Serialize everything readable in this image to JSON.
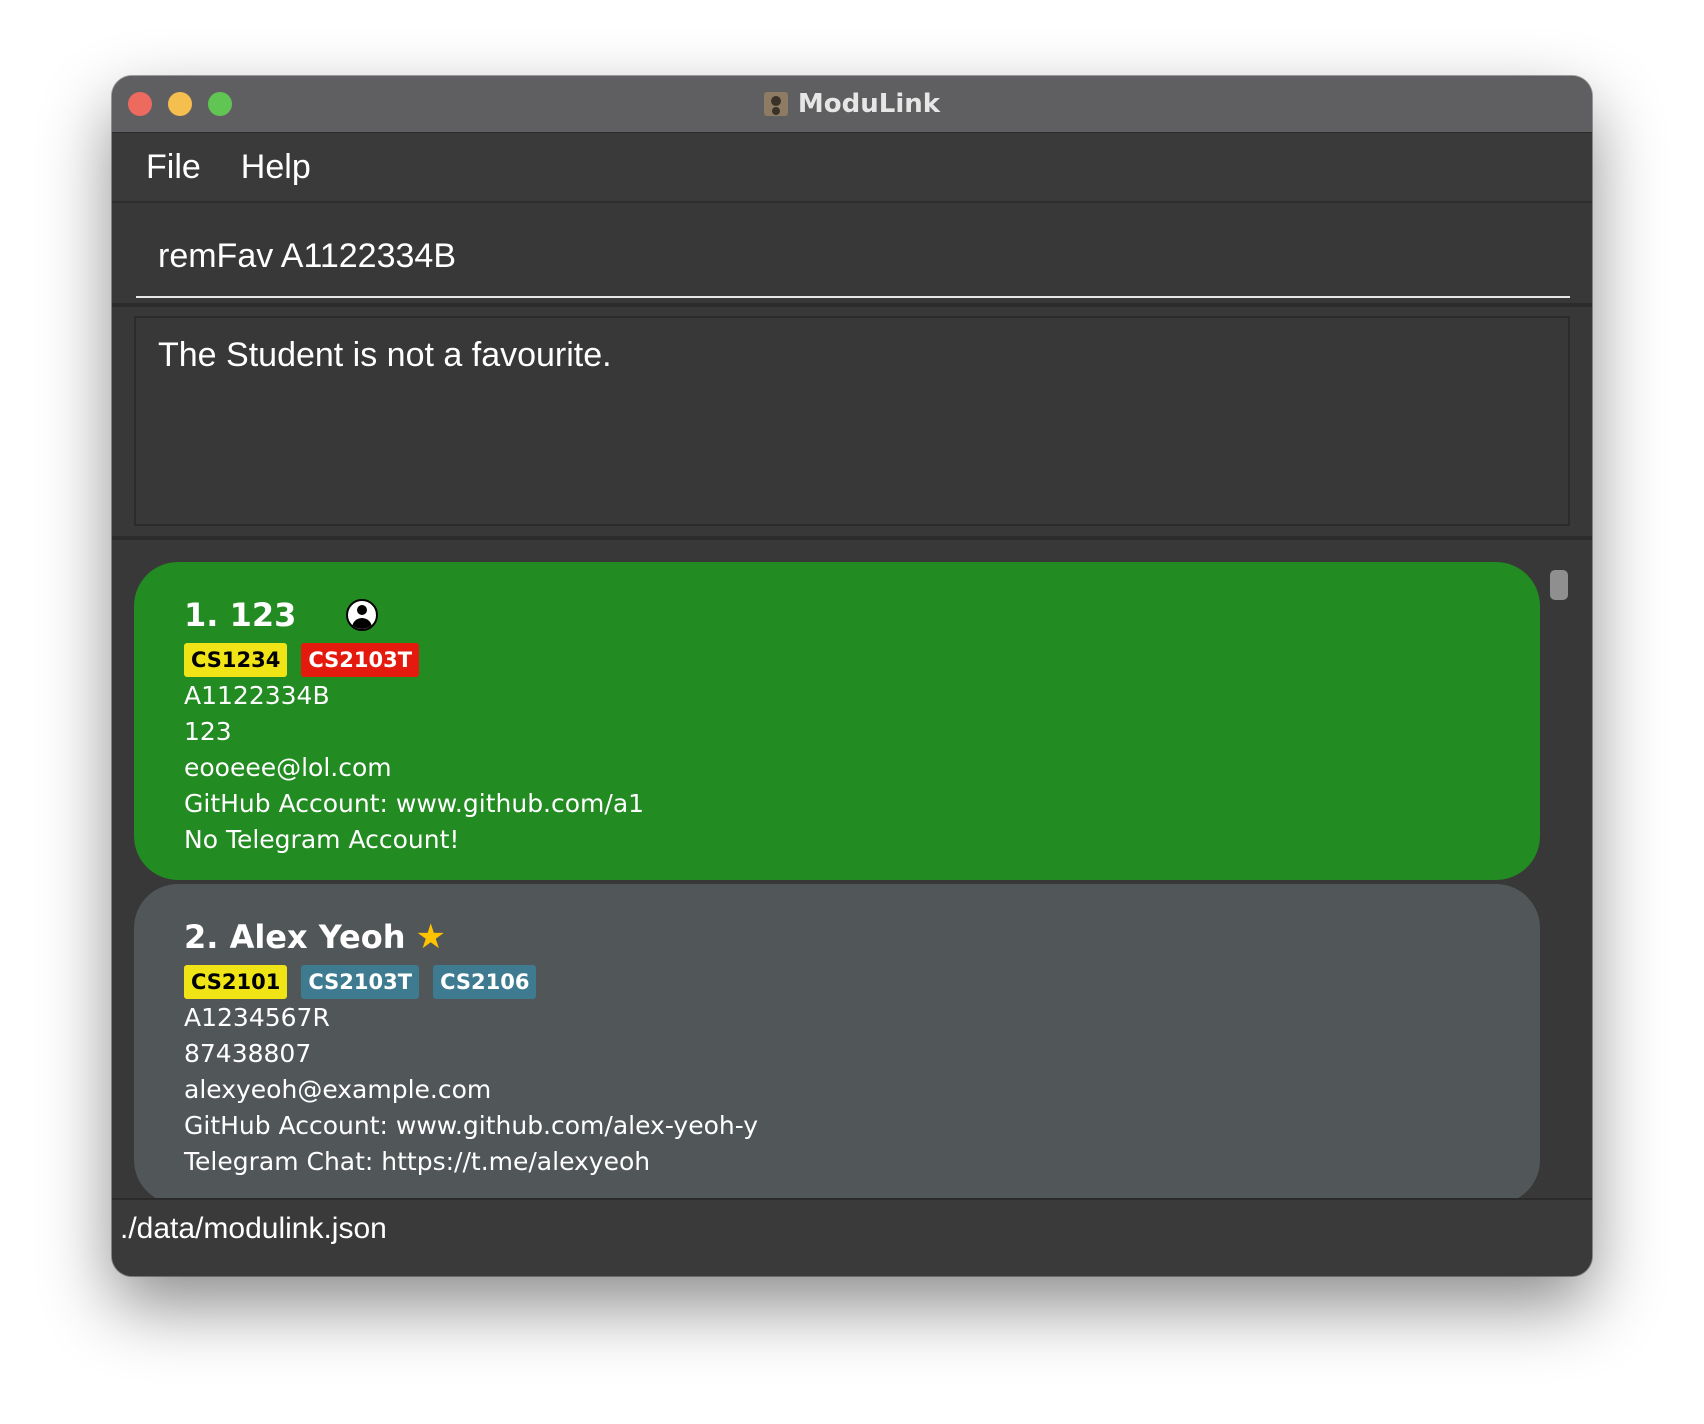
{
  "window": {
    "title": "ModuLink"
  },
  "menu": {
    "file": "File",
    "help": "Help"
  },
  "command": {
    "value": "remFav A1122334B"
  },
  "result": {
    "text": "The Student is not a favourite."
  },
  "students": [
    {
      "name": "1. 123",
      "icon": "person-icon",
      "tags": [
        "CS1234",
        "CS2103T"
      ],
      "id": "A1122334B",
      "phone": "123",
      "email": "eooeee@lol.com",
      "github": "GitHub Account: www.github.com/a1",
      "telegram": "No Telegram Account!"
    },
    {
      "name": "2. Alex Yeoh",
      "icon": "star-icon",
      "tags": [
        "CS2101",
        "CS2103T",
        "CS2106"
      ],
      "id": "A1234567R",
      "phone": "87438807",
      "email": "alexyeoh@example.com",
      "github": "GitHub Account: www.github.com/alex-yeoh-y",
      "telegram": "Telegram Chat: https://t.me/alexyeoh"
    }
  ],
  "status": {
    "path": "./data/modulink.json"
  },
  "colors": {
    "selected_card": "#228b22",
    "normal_card": "#515658",
    "tag_yellow": "#f0e416",
    "tag_red": "#e51a0f",
    "tag_blue": "#3e7b91"
  }
}
